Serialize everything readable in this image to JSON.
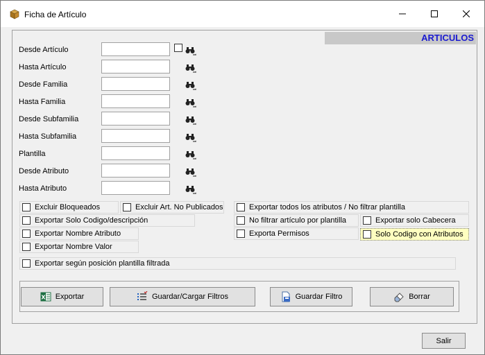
{
  "window": {
    "title": "Ficha de Artículo",
    "minimize_symbol": "—",
    "maximize_symbol": "☐",
    "close_symbol": "✕"
  },
  "header": {
    "banner": "ARTICULOS"
  },
  "filters": [
    {
      "label": "Desde Artículo",
      "value": ""
    },
    {
      "label": "Hasta Artículo",
      "value": ""
    },
    {
      "label": "Desde Familia",
      "value": ""
    },
    {
      "label": "Hasta Familia",
      "value": ""
    },
    {
      "label": "Desde Subfamilia",
      "value": ""
    },
    {
      "label": "Hasta Subfamilia",
      "value": ""
    },
    {
      "label": "Plantilla",
      "value": ""
    },
    {
      "label": "Desde Atributo",
      "value": ""
    },
    {
      "label": "Hasta Atributo",
      "value": ""
    }
  ],
  "options": {
    "excluir_bloqueados": "Excluir Bloqueados",
    "excluir_no_publicados": "Excluir Art. No Publicados",
    "exportar_todos_atributos": "Exportar todos los atributos / No filtrar plantilla",
    "exportar_solo_codigo": "Exportar  Solo Codigo/descripción",
    "no_filtrar_plantilla": "No filtrar artículo por plantilla",
    "exportar_solo_cabecera": "Exportar solo Cabecera",
    "exportar_nombre_atributo": "Exportar Nombre Atributo",
    "exporta_permisos": "Exporta Permisos",
    "solo_codigo_atributos": "Solo Codigo con Atributos",
    "exportar_nombre_valor": "Exportar Nombre Valor",
    "exportar_posicion_plantilla": "Exportar según posición plantilla filtrada"
  },
  "buttons": {
    "exportar": "Exportar",
    "guardar_cargar": "Guardar/Cargar Filtros",
    "guardar_filtro": "Guardar Filtro",
    "borrar": "Borrar",
    "salir": "Salir"
  },
  "colors": {
    "banner_text": "#1a1ad0",
    "banner_bg": "#c8c8c8",
    "highlight": "#ffffc0"
  },
  "icons": {
    "app": "package-icon",
    "lookup": "binoculars-icon",
    "exportar": "excel-icon",
    "guardar_cargar": "list-check-icon",
    "guardar_filtro": "save-document-icon",
    "borrar": "eraser-icon"
  }
}
